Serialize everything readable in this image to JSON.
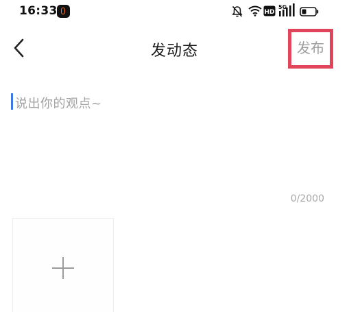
{
  "status_bar": {
    "time": "16:33",
    "icons": [
      "app-notification-icon",
      "bell-muted-icon",
      "wifi-icon",
      "hd-icon",
      "5g-signal-icon",
      "battery-icon"
    ],
    "hd_label": "HD",
    "network_label": "5G"
  },
  "header": {
    "back_icon": "chevron-left-icon",
    "title": "发动态",
    "publish_label": "发布"
  },
  "editor": {
    "placeholder": "说出你的观点~",
    "char_count": "0/2000"
  },
  "media": {
    "add_icon": "plus-icon"
  },
  "colors": {
    "highlight": "#e0455c",
    "caret": "#3d78e0",
    "muted_text": "#a3a3a3"
  }
}
